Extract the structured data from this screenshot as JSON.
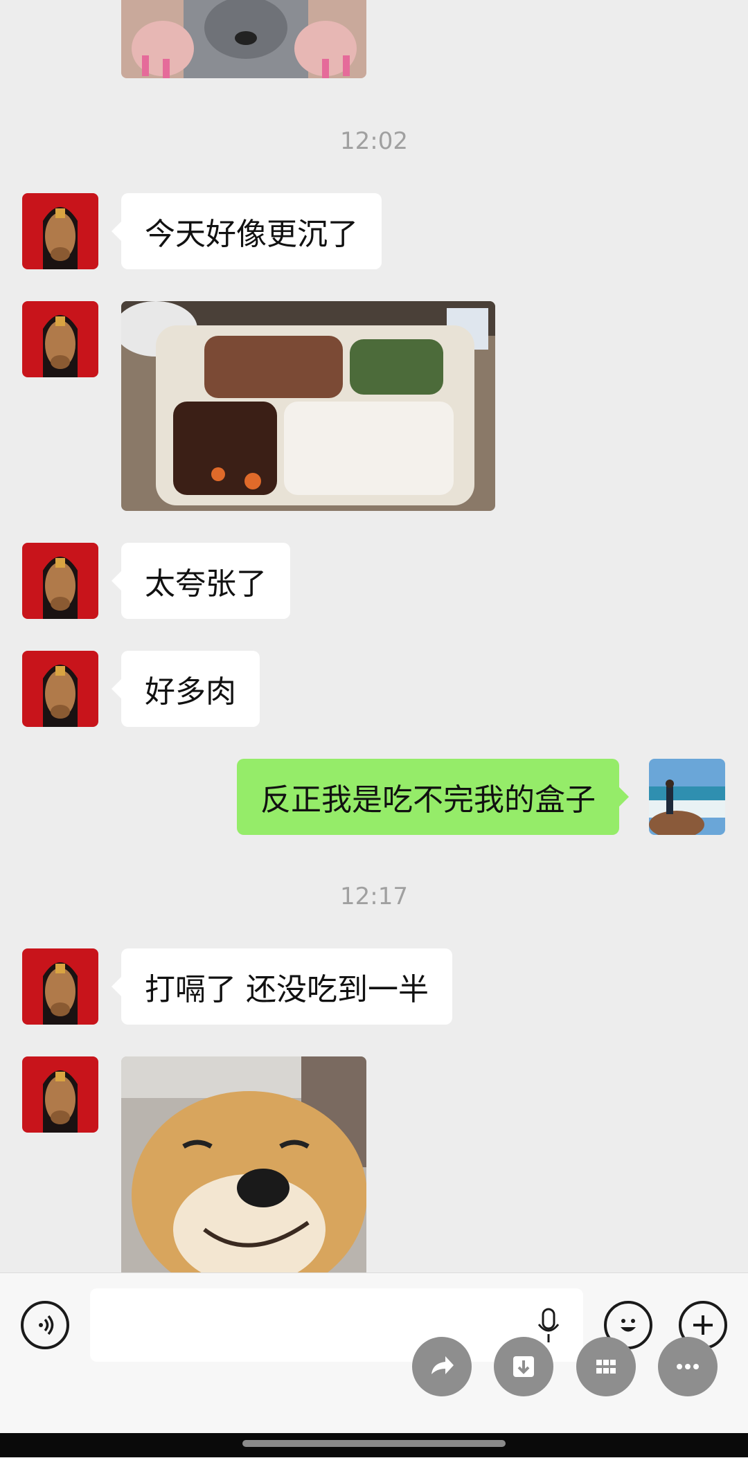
{
  "chat": {
    "timestamps": [
      "12:02",
      "12:17"
    ],
    "messages": [
      {
        "from": "friend",
        "type": "text",
        "text": "今天好像更沉了"
      },
      {
        "from": "friend",
        "type": "image",
        "image": "bento-box-meal-photo"
      },
      {
        "from": "friend",
        "type": "text",
        "text": "太夸张了"
      },
      {
        "from": "friend",
        "type": "text",
        "text": "好多肉"
      },
      {
        "from": "me",
        "type": "text",
        "text": "反正我是吃不完我的盒子"
      },
      {
        "from": "friend",
        "type": "text",
        "text": "打嗝了 还没吃到一半"
      },
      {
        "from": "friend",
        "type": "image",
        "image": "smiling-shiba-dog-photo"
      }
    ]
  },
  "input_bar": {
    "icons": [
      "voice-icon",
      "microphone-icon",
      "emoji-icon",
      "plus-icon"
    ],
    "input_value": ""
  },
  "floating_actions": [
    "share-icon",
    "save-icon",
    "grid-icon",
    "more-icon"
  ],
  "colors": {
    "background": "#ededed",
    "incoming_bubble": "#ffffff",
    "outgoing_bubble": "#95ec69",
    "timestamp": "#a0a0a0",
    "fab": "#8e8e8e"
  }
}
